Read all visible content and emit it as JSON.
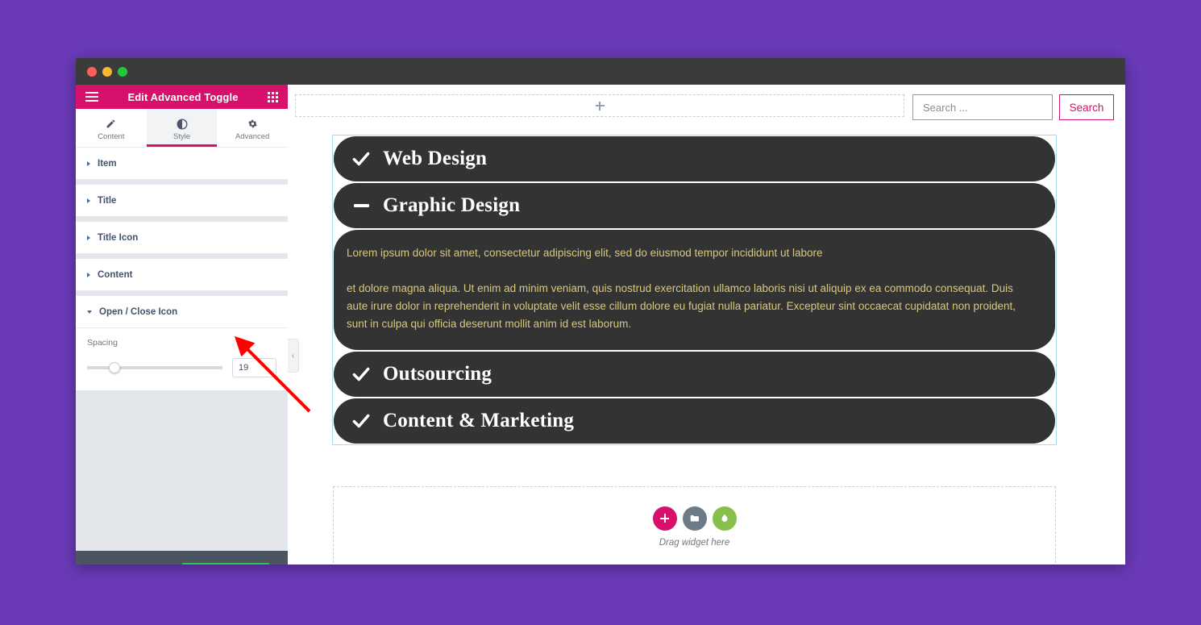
{
  "theme": {
    "page_background": "#6a3ab8",
    "panel_accent": "#d6106b",
    "toggle_bar_bg": "#333333",
    "toggle_content_text": "#d9c87a",
    "annotation_color": "#ff0000",
    "selection_outline": "#a8dbf0"
  },
  "window": {
    "traffic_lights": [
      "close-red",
      "minimize-yellow",
      "maximize-green"
    ]
  },
  "panel": {
    "header": {
      "title": "Edit Advanced Toggle",
      "menu_icon": "hamburger-icon",
      "apps_icon": "grid-apps-icon"
    },
    "tabs": [
      {
        "label": "Content",
        "icon": "pencil-icon",
        "active": false
      },
      {
        "label": "Style",
        "icon": "contrast-half-circle-icon",
        "active": true
      },
      {
        "label": "Advanced",
        "icon": "gear-icon",
        "active": false
      }
    ],
    "sections": [
      {
        "label": "Item",
        "state": "collapsed",
        "icon": "caret-right-icon"
      },
      {
        "label": "Title",
        "state": "collapsed",
        "icon": "caret-right-icon"
      },
      {
        "label": "Title Icon",
        "state": "collapsed",
        "icon": "caret-right-icon"
      },
      {
        "label": "Content",
        "state": "collapsed",
        "icon": "caret-right-icon"
      },
      {
        "label": "Open / Close Icon",
        "state": "expanded",
        "icon": "caret-down-icon"
      }
    ],
    "controls": {
      "spacing": {
        "label": "Spacing",
        "value": "19",
        "slider_percent": 20
      }
    },
    "collapse_handle_icon": "chevron-left-icon"
  },
  "canvas": {
    "add_section": {
      "icon": "plus-icon",
      "tooltip": "Add new section"
    },
    "search": {
      "placeholder": "Search ...",
      "value": "",
      "button_label": "Search"
    },
    "toggle_items": [
      {
        "title": "Web Design",
        "icon": "check-icon",
        "state": "closed",
        "content": null
      },
      {
        "title": "Graphic Design",
        "icon": "minus-icon",
        "state": "open",
        "content": [
          "Lorem ipsum dolor sit amet, consectetur adipiscing elit, sed do eiusmod tempor incididunt ut labore",
          "et dolore magna aliqua. Ut enim ad minim veniam, quis nostrud exercitation ullamco laboris nisi ut aliquip ex ea commodo consequat. Duis aute irure dolor in reprehenderit in voluptate velit esse cillum dolore eu fugiat nulla pariatur. Excepteur sint occaecat cupidatat non proident, sunt in culpa qui officia deserunt mollit anim id est laborum."
        ]
      },
      {
        "title": "Outsourcing",
        "icon": "check-icon",
        "state": "closed",
        "content": null
      },
      {
        "title": "Content & Marketing",
        "icon": "check-icon",
        "state": "closed",
        "content": null
      }
    ],
    "drop_area": {
      "label": "Drag widget here",
      "buttons": [
        {
          "icon": "plus-icon",
          "color": "#d6106b",
          "name": "add-widget"
        },
        {
          "icon": "folder-icon",
          "color": "#6d7a87",
          "name": "add-template"
        },
        {
          "icon": "leaf-icon",
          "color": "#86bf4a",
          "name": "add-envato-block"
        }
      ]
    }
  }
}
